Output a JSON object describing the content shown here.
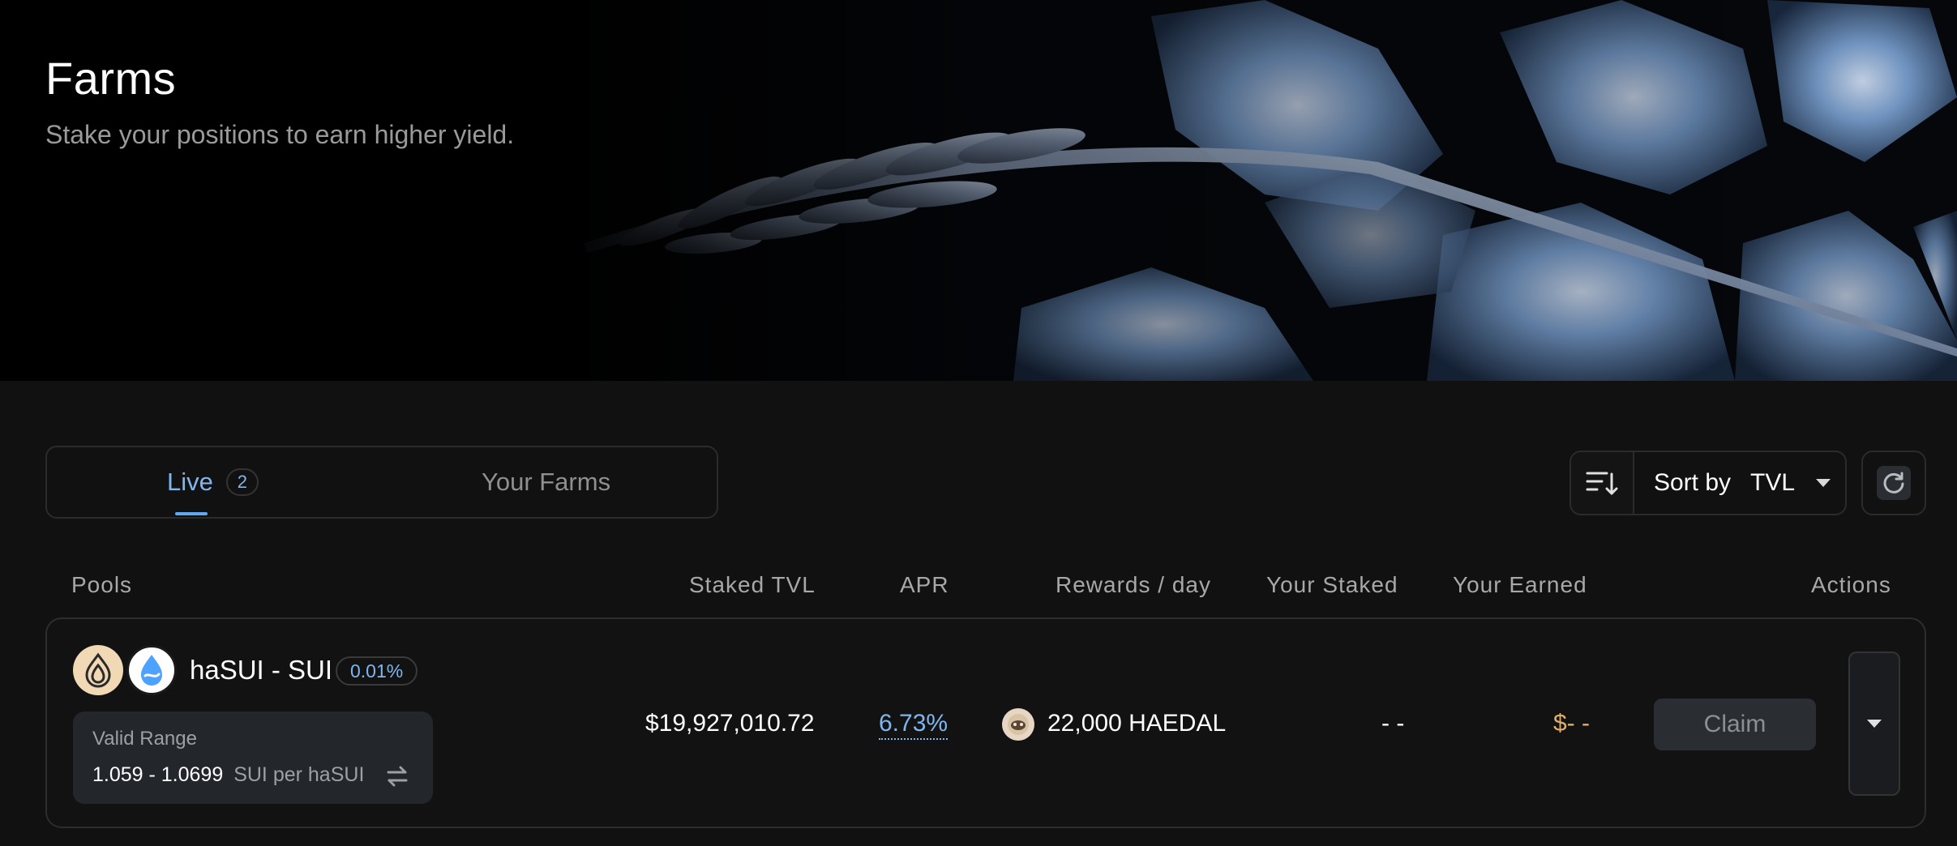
{
  "hero": {
    "title": "Farms",
    "subtitle": "Stake your positions to earn higher yield."
  },
  "tabs": [
    {
      "label": "Live",
      "count": "2",
      "active": true
    },
    {
      "label": "Your Farms",
      "active": false
    }
  ],
  "sort": {
    "label": "Sort by",
    "value": "TVL",
    "icon": "sort-lines-icon"
  },
  "refresh": {
    "icon": "refresh-icon"
  },
  "columns": [
    "Pools",
    "Staked TVL",
    "APR",
    "Rewards / day",
    "Your Staked",
    "Your Earned",
    "Actions"
  ],
  "farms": [
    {
      "pair": "haSUI - SUI",
      "token_icons": [
        "hasui-token-icon",
        "sui-token-icon"
      ],
      "fee": "0.01%",
      "range_label": "Valid Range",
      "range_values": "1.059 - 1.0699",
      "range_unit": "SUI per haSUI",
      "staked_tvl": "$19,927,010.72",
      "apr": "6.73%",
      "reward_token_icon": "haedal-token-icon",
      "rewards_per_day": "22,000 HAEDAL",
      "your_staked": "- -",
      "your_earned": "$- -",
      "claim_label": "Claim"
    }
  ],
  "colors": {
    "background": "#111111",
    "accent": "#7fb6ee",
    "earned": "#e2b06d",
    "muted_text": "#a8a8a8"
  }
}
